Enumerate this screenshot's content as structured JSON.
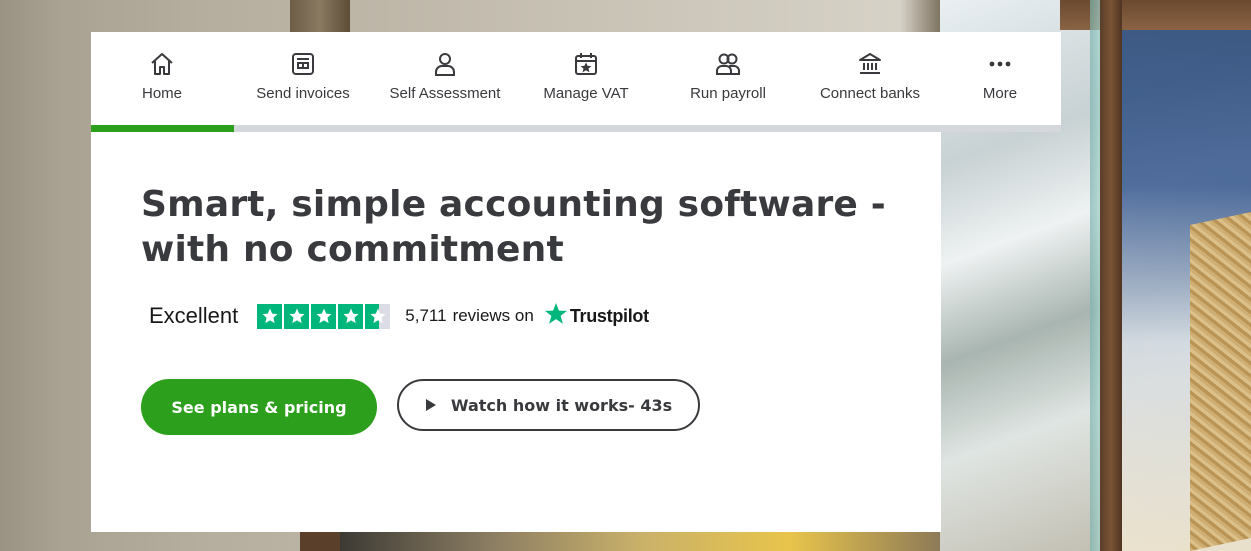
{
  "nav": {
    "items": [
      {
        "label": "Home",
        "icon": "home-icon"
      },
      {
        "label": "Send invoices",
        "icon": "invoice-icon"
      },
      {
        "label": "Self Assessment",
        "icon": "person-icon"
      },
      {
        "label": "Manage VAT",
        "icon": "calendar-star-icon"
      },
      {
        "label": "Run payroll",
        "icon": "people-icon"
      },
      {
        "label": "Connect banks",
        "icon": "bank-icon"
      },
      {
        "label": "More",
        "icon": "more-dots-icon"
      }
    ],
    "progress": 0.147,
    "progress_color": "#2ca01c"
  },
  "hero": {
    "headline": "Smart, simple accounting software - with no commitment",
    "rating": {
      "label": "Excellent",
      "stars": 4.5,
      "review_count": "5,711",
      "reviews_on": "reviews on",
      "provider": "Trustpilot",
      "star_color": "#00b67a"
    },
    "cta_primary": "See plans & pricing",
    "cta_secondary": "Watch how it works- 43s"
  },
  "colors": {
    "brand_green": "#2ca01c",
    "text_dark": "#393a3d"
  }
}
